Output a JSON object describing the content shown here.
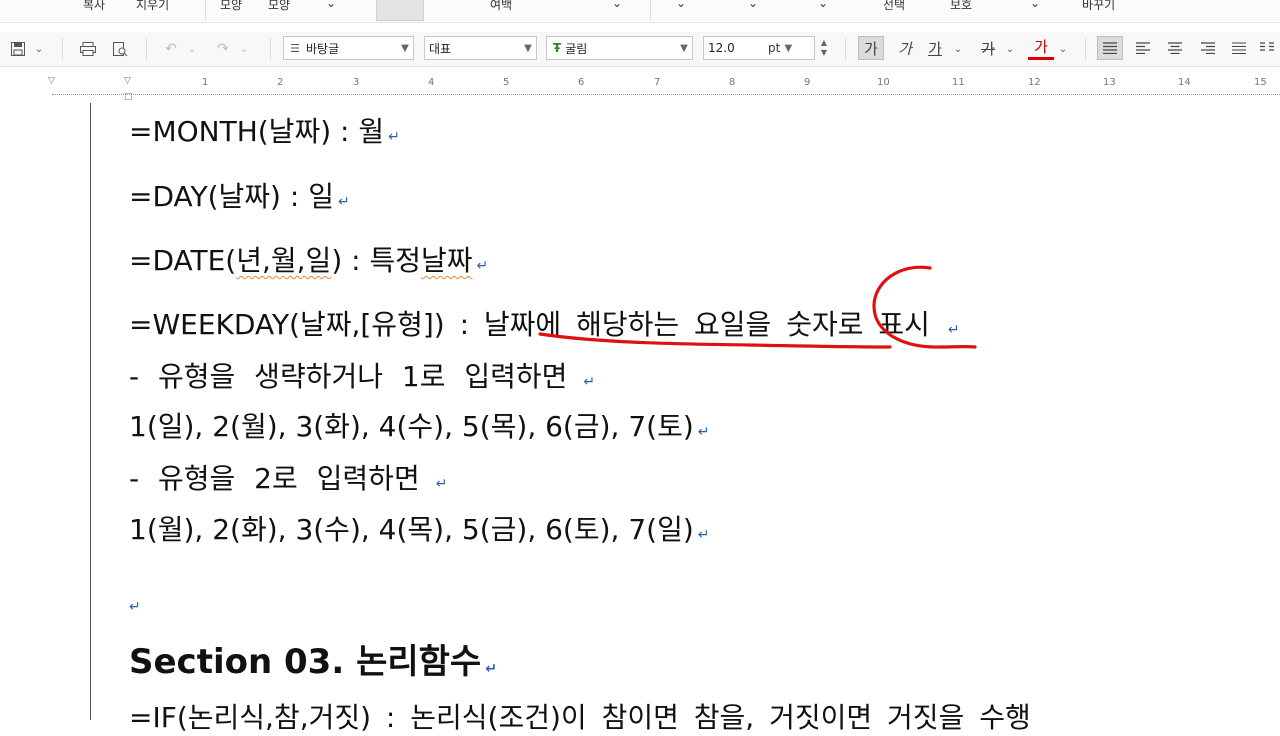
{
  "ribbon": {
    "labels": [
      "복사",
      "지우기",
      "모양",
      "모양",
      "여백",
      "선택",
      "보호",
      "바꾸기"
    ]
  },
  "toolbar": {
    "style_box": "바탕글",
    "lang_box": "대표",
    "font_box": "굴림",
    "size_value": "12.0",
    "size_unit": "pt",
    "bold_label": "가",
    "italic_label": "가",
    "underline_label": "가",
    "strike_label": "가",
    "color_label": "가"
  },
  "ruler": {
    "numbers": [
      "1",
      "2",
      "3",
      "4",
      "5",
      "6",
      "7",
      "8",
      "9",
      "10",
      "11",
      "12",
      "13",
      "14",
      "15"
    ]
  },
  "colors": {
    "ink": "#e01010",
    "paragraph_mark": "#2b5fb3"
  },
  "document": {
    "line1": "=MONTH(날짜) : 월",
    "line2": "=DAY(날짜) : 일",
    "line3_a": "=DATE(",
    "line3_b": "년,월,일",
    "line3_c": ") : 특정",
    "line3_d": "날짜",
    "line4": "=WEEKDAY(날짜,[유형]) : 날짜에 해당하는 요일을 숫자로 표시",
    "line5": "- 유형을 생략하거나 1로 입력하면",
    "line6": "1(일), 2(월), 3(화), 4(수), 5(목), 6(금), 7(토)",
    "line7": "- 유형을 2로 입력하면",
    "line8": "1(월), 2(화), 3(수), 4(목), 5(금), 6(토), 7(일)",
    "section_heading": "Section 03. 논리함수",
    "line_partial": "=IF(논리식,참,거짓) : 논리식(조건)이 참이면 참을, 거짓이면 거짓을 수행",
    "para_mark": "↵"
  }
}
